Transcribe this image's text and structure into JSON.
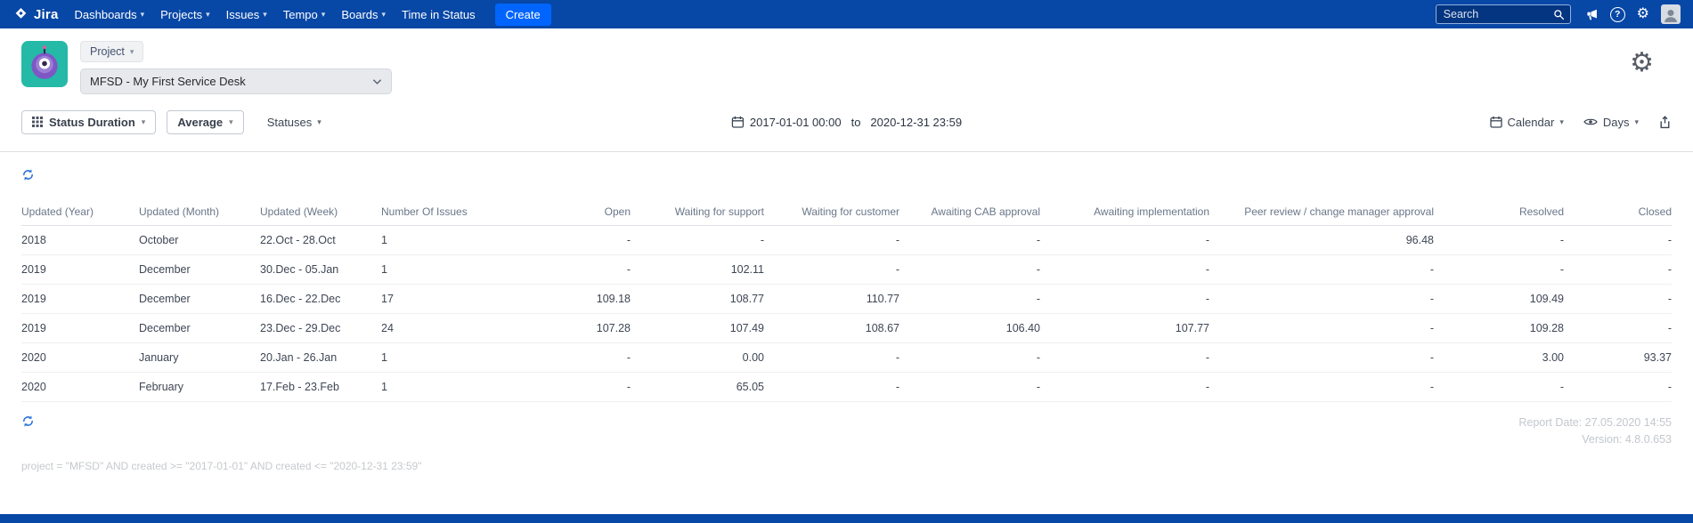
{
  "navbar": {
    "brand": "Jira",
    "menu": [
      {
        "label": "Dashboards",
        "caret": true
      },
      {
        "label": "Projects",
        "caret": true
      },
      {
        "label": "Issues",
        "caret": true
      },
      {
        "label": "Tempo",
        "caret": true
      },
      {
        "label": "Boards",
        "caret": true
      },
      {
        "label": "Time in Status",
        "caret": false
      }
    ],
    "create_label": "Create",
    "search_placeholder": "Search"
  },
  "icons": {
    "caret": "▾",
    "gear": "⚙",
    "help": "?"
  },
  "project_bar": {
    "scope_label": "Project",
    "project_select": "MFSD - My First Service Desk"
  },
  "toolbar": {
    "report_type": "Status Duration",
    "aggregation": "Average",
    "statuses_label": "Statuses",
    "date_from": "2017-01-01 00:00",
    "to_label": "to",
    "date_to": "2020-12-31 23:59",
    "calendar_label": "Calendar",
    "unit_label": "Days"
  },
  "table": {
    "columns": [
      "Updated (Year)",
      "Updated (Month)",
      "Updated (Week)",
      "Number Of Issues",
      "Open",
      "Waiting for support",
      "Waiting for customer",
      "Awaiting CAB approval",
      "Awaiting implementation",
      "Peer review / change manager approval",
      "Resolved",
      "Closed"
    ],
    "rows": [
      [
        "2018",
        "October",
        "22.Oct - 28.Oct",
        "1",
        "-",
        "-",
        "-",
        "-",
        "-",
        "96.48",
        "-",
        "-"
      ],
      [
        "2019",
        "December",
        "30.Dec - 05.Jan",
        "1",
        "-",
        "102.11",
        "-",
        "-",
        "-",
        "-",
        "-",
        "-"
      ],
      [
        "2019",
        "December",
        "16.Dec - 22.Dec",
        "17",
        "109.18",
        "108.77",
        "110.77",
        "-",
        "-",
        "-",
        "109.49",
        "-"
      ],
      [
        "2019",
        "December",
        "23.Dec - 29.Dec",
        "24",
        "107.28",
        "107.49",
        "108.67",
        "106.40",
        "107.77",
        "-",
        "109.28",
        "-"
      ],
      [
        "2020",
        "January",
        "20.Jan - 26.Jan",
        "1",
        "-",
        "0.00",
        "-",
        "-",
        "-",
        "-",
        "3.00",
        "93.37"
      ],
      [
        "2020",
        "February",
        "17.Feb - 23.Feb",
        "1",
        "-",
        "65.05",
        "-",
        "-",
        "-",
        "-",
        "-",
        "-"
      ]
    ]
  },
  "footer": {
    "report_date": "Report Date: 27.05.2020 14:55",
    "version": "Version: 4.8.0.653",
    "query": "project = \"MFSD\" AND created >= \"2017-01-01\" AND created <= \"2020-12-31 23:59\""
  },
  "colors": {
    "navbar_bg": "#0747a6",
    "create_button": "#0065ff",
    "refresh_icon": "#2470d6"
  }
}
